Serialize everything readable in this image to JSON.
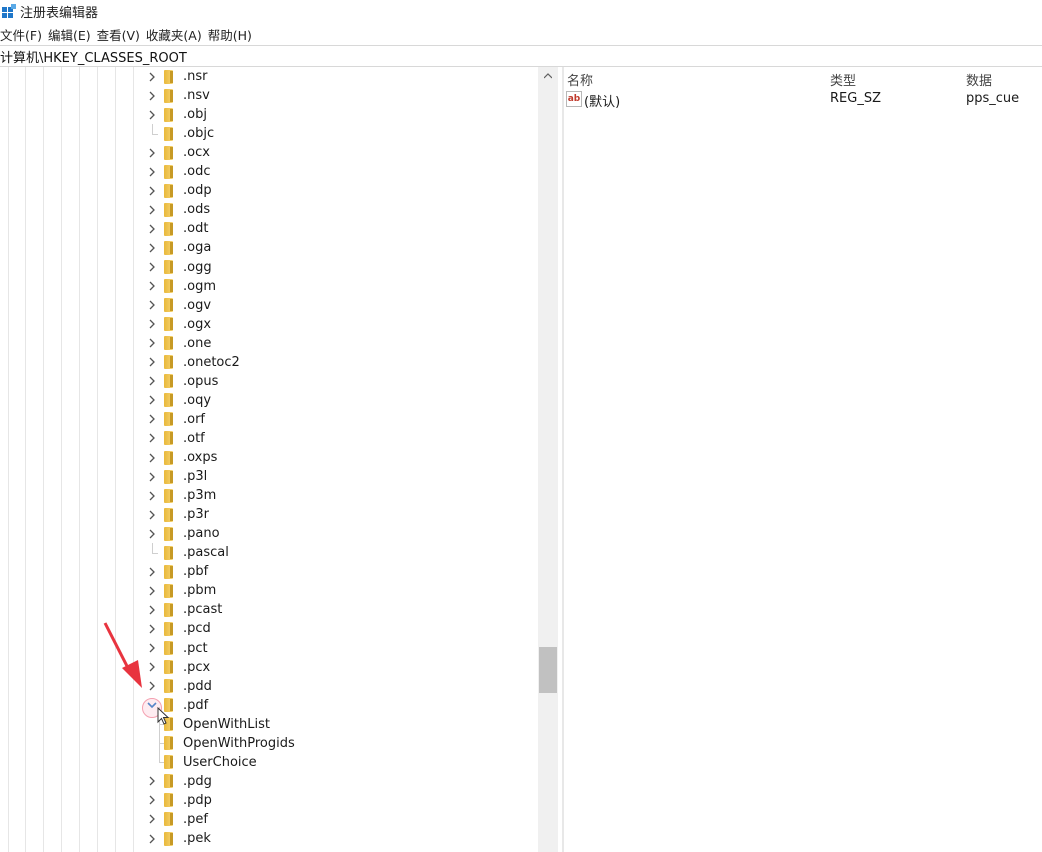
{
  "window": {
    "title": "注册表编辑器",
    "icon": "registry-editor-icon"
  },
  "menu": {
    "items": [
      "文件(F)",
      "编辑(E)",
      "查看(V)",
      "收藏夹(A)",
      "帮助(H)"
    ]
  },
  "address": {
    "path": "计算机\\HKEY_CLASSES_ROOT"
  },
  "tree": {
    "rows": [
      {
        "label": ".nsr",
        "expandable": true
      },
      {
        "label": ".nsv",
        "expandable": true
      },
      {
        "label": ".obj",
        "expandable": true
      },
      {
        "label": ".objc",
        "expandable": false
      },
      {
        "label": ".ocx",
        "expandable": true
      },
      {
        "label": ".odc",
        "expandable": true
      },
      {
        "label": ".odp",
        "expandable": true
      },
      {
        "label": ".ods",
        "expandable": true
      },
      {
        "label": ".odt",
        "expandable": true
      },
      {
        "label": ".oga",
        "expandable": true
      },
      {
        "label": ".ogg",
        "expandable": true
      },
      {
        "label": ".ogm",
        "expandable": true
      },
      {
        "label": ".ogv",
        "expandable": true
      },
      {
        "label": ".ogx",
        "expandable": true
      },
      {
        "label": ".one",
        "expandable": true
      },
      {
        "label": ".onetoc2",
        "expandable": true
      },
      {
        "label": ".opus",
        "expandable": true
      },
      {
        "label": ".oqy",
        "expandable": true
      },
      {
        "label": ".orf",
        "expandable": true
      },
      {
        "label": ".otf",
        "expandable": true
      },
      {
        "label": ".oxps",
        "expandable": true
      },
      {
        "label": ".p3l",
        "expandable": true
      },
      {
        "label": ".p3m",
        "expandable": true
      },
      {
        "label": ".p3r",
        "expandable": true
      },
      {
        "label": ".pano",
        "expandable": true
      },
      {
        "label": ".pascal",
        "expandable": false
      },
      {
        "label": ".pbf",
        "expandable": true
      },
      {
        "label": ".pbm",
        "expandable": true
      },
      {
        "label": ".pcast",
        "expandable": true
      },
      {
        "label": ".pcd",
        "expandable": true
      },
      {
        "label": ".pct",
        "expandable": true
      },
      {
        "label": ".pcx",
        "expandable": true
      },
      {
        "label": ".pdd",
        "expandable": true
      },
      {
        "label": ".pdf",
        "expandable": true,
        "expanded": true
      },
      {
        "label": "OpenWithList",
        "child": true
      },
      {
        "label": "OpenWithProgids",
        "child": true
      },
      {
        "label": "UserChoice",
        "child": true
      },
      {
        "label": ".pdg",
        "expandable": true
      },
      {
        "label": ".pdp",
        "expandable": true
      },
      {
        "label": ".pef",
        "expandable": true
      },
      {
        "label": ".pek",
        "expandable": true
      }
    ]
  },
  "list": {
    "headers": {
      "name": "名称",
      "type": "类型",
      "data": "数据"
    },
    "values": [
      {
        "icon": "string-value-icon",
        "icon_text": "ab",
        "name": "(默认)",
        "type": "REG_SZ",
        "data": "pps_cue"
      }
    ]
  },
  "colors": {
    "folder": "#e9b83a",
    "arrow": "#e8343f",
    "accent": "#1f77c9"
  }
}
